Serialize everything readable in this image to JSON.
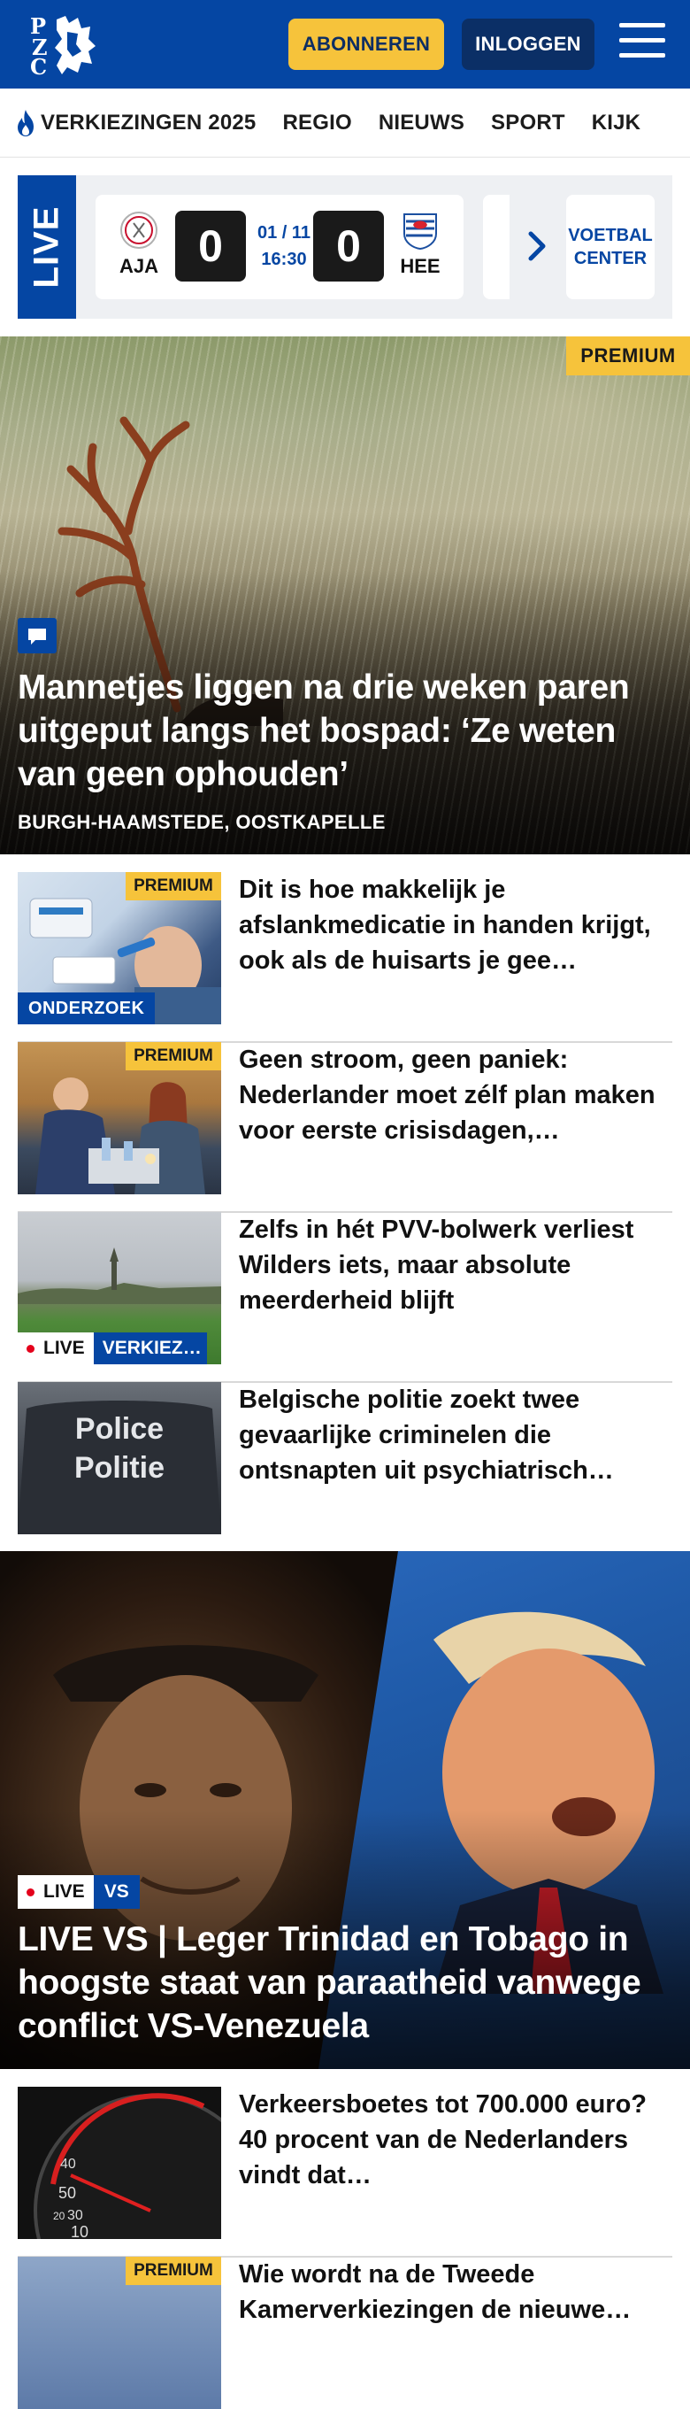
{
  "header": {
    "logo_letters": [
      "P",
      "Z",
      "C"
    ],
    "subscribe_label": "ABONNEREN",
    "login_label": "INLOGGEN",
    "colors": {
      "brand_blue": "#0546a3",
      "accent_yellow": "#f6c33b"
    }
  },
  "nav": {
    "items": [
      "VERKIEZINGEN 2025",
      "REGIO",
      "NIEUWS",
      "SPORT",
      "KIJK"
    ]
  },
  "livebar": {
    "label": "LIVE",
    "match": {
      "home_abbr": "AJA",
      "away_abbr": "HEE",
      "home_score": "0",
      "away_score": "0",
      "date": "01 / 11",
      "time": "16:30"
    },
    "voetbal_center_line1": "VOETBAL",
    "voetbal_center_line2": "CENTER"
  },
  "hero": {
    "badge": "PREMIUM",
    "title": "Mannetjes liggen na drie weken paren uitgeput langs het bospad: ‘Ze weten van geen ophouden’",
    "location": "BURGH-HAAMSTEDE, OOSTKAPELLE"
  },
  "articles": [
    {
      "title": "Dit is hoe makkelijk je afslankmedicatie in handen krijgt, ook als de huisarts je gee…",
      "premium": "PREMIUM",
      "tag": "ONDERZOEK"
    },
    {
      "title": "Geen stroom, geen paniek: Nederlander moet zélf plan maken voor eerste crisisdagen,…",
      "premium": "PREMIUM"
    },
    {
      "title": "Zelfs in hét PVV-bolwerk verliest Wilders iets, maar absolute meerderheid blijft",
      "live": "LIVE",
      "tag": "VERKIEZ…"
    },
    {
      "title": "Belgische politie zoekt twee gevaarlijke criminelen die ontsnapten uit psychiatrisch…",
      "thumb_text_1": "Police",
      "thumb_text_2": "Politie"
    }
  ],
  "feature": {
    "live": "LIVE",
    "tag": "VS",
    "title": "LIVE VS | Leger Trinidad en Tobago in hoogste staat van paraatheid vanwege conflict VS-Venezuela"
  },
  "articles_bottom": [
    {
      "title": "Verkeersboetes tot 700.000 euro? 40 procent van de Nederlanders vindt dat…",
      "speedo_labels": [
        "40",
        "50",
        "30",
        "20",
        "10"
      ]
    },
    {
      "premium": "PREMIUM",
      "title": "Wie wordt na de Tweede Kamerverkiezingen de nieuwe…"
    }
  ]
}
